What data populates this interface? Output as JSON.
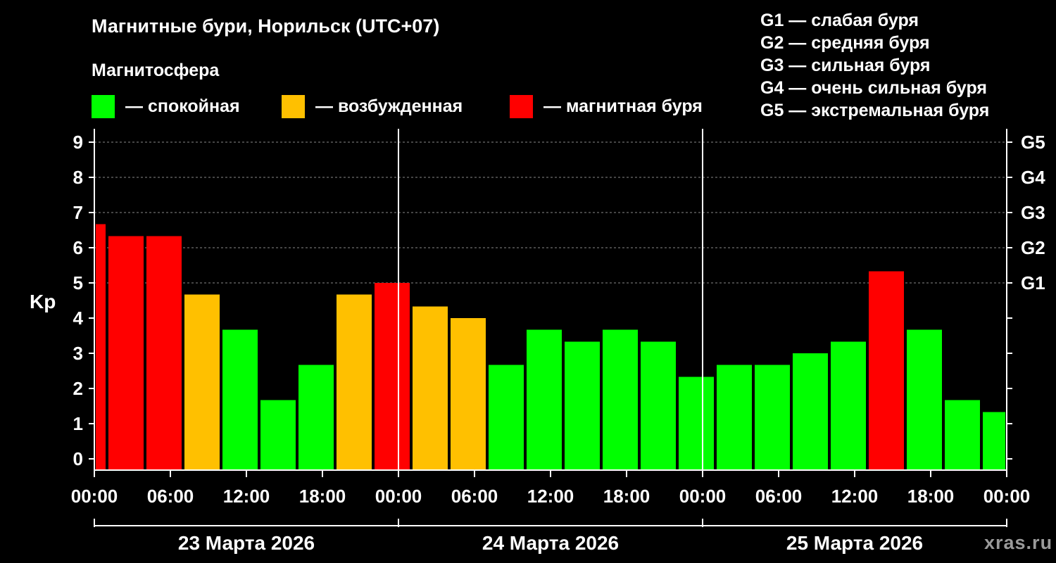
{
  "title": "Магнитные бури, Норильск (UTC+07)",
  "subtitle": "Магнитосфера",
  "legend": [
    {
      "label": "— спокойная",
      "color": "#00ff00"
    },
    {
      "label": "— возбужденная",
      "color": "#ffc000"
    },
    {
      "label": "— магнитная буря",
      "color": "#ff0000"
    }
  ],
  "g_legend": [
    "G1 — слабая буря",
    "G2 — средняя буря",
    "G3 — сильная буря",
    "G4 — очень сильная буря",
    "G5 — экстремальная буря"
  ],
  "watermark": "xras.ru",
  "chart_data": {
    "type": "bar",
    "ylabel": "Kp",
    "ylim": [
      0,
      9
    ],
    "yticks": [
      "0",
      "1",
      "2",
      "3",
      "4",
      "5",
      "6",
      "7",
      "8",
      "9"
    ],
    "right_labels": [
      {
        "value": 5,
        "label": "G1"
      },
      {
        "value": 6,
        "label": "G2"
      },
      {
        "value": 7,
        "label": "G3"
      },
      {
        "value": 8,
        "label": "G4"
      },
      {
        "value": 9,
        "label": "G5"
      }
    ],
    "x_tick_labels": [
      "00:00",
      "06:00",
      "12:00",
      "18:00",
      "00:00",
      "06:00",
      "12:00",
      "18:00",
      "00:00",
      "06:00",
      "12:00",
      "18:00",
      "00:00"
    ],
    "day_labels": [
      "23 Марта 2026",
      "24 Марта 2026",
      "25 Марта 2026"
    ],
    "grid": "horizontal dashed at 5-9",
    "bars": [
      {
        "start_hour": 0,
        "end_hour": 1,
        "value": 6.67,
        "color": "#ff0000"
      },
      {
        "start_hour": 1,
        "end_hour": 4,
        "value": 6.33,
        "color": "#ff0000"
      },
      {
        "start_hour": 4,
        "end_hour": 7,
        "value": 6.33,
        "color": "#ff0000"
      },
      {
        "start_hour": 7,
        "end_hour": 10,
        "value": 4.67,
        "color": "#ffc000"
      },
      {
        "start_hour": 10,
        "end_hour": 13,
        "value": 3.67,
        "color": "#00ff00"
      },
      {
        "start_hour": 13,
        "end_hour": 16,
        "value": 1.67,
        "color": "#00ff00"
      },
      {
        "start_hour": 16,
        "end_hour": 19,
        "value": 2.67,
        "color": "#00ff00"
      },
      {
        "start_hour": 19,
        "end_hour": 22,
        "value": 4.67,
        "color": "#ffc000"
      },
      {
        "start_hour": 22,
        "end_hour": 25,
        "value": 5.0,
        "color": "#ff0000"
      },
      {
        "start_hour": 25,
        "end_hour": 28,
        "value": 4.33,
        "color": "#ffc000"
      },
      {
        "start_hour": 28,
        "end_hour": 31,
        "value": 4.0,
        "color": "#ffc000"
      },
      {
        "start_hour": 31,
        "end_hour": 34,
        "value": 2.67,
        "color": "#00ff00"
      },
      {
        "start_hour": 34,
        "end_hour": 37,
        "value": 3.67,
        "color": "#00ff00"
      },
      {
        "start_hour": 37,
        "end_hour": 40,
        "value": 3.33,
        "color": "#00ff00"
      },
      {
        "start_hour": 40,
        "end_hour": 43,
        "value": 3.67,
        "color": "#00ff00"
      },
      {
        "start_hour": 43,
        "end_hour": 46,
        "value": 3.33,
        "color": "#00ff00"
      },
      {
        "start_hour": 46,
        "end_hour": 49,
        "value": 2.33,
        "color": "#00ff00"
      },
      {
        "start_hour": 49,
        "end_hour": 52,
        "value": 2.67,
        "color": "#00ff00"
      },
      {
        "start_hour": 52,
        "end_hour": 55,
        "value": 2.67,
        "color": "#00ff00"
      },
      {
        "start_hour": 55,
        "end_hour": 58,
        "value": 3.0,
        "color": "#00ff00"
      },
      {
        "start_hour": 58,
        "end_hour": 61,
        "value": 3.33,
        "color": "#00ff00"
      },
      {
        "start_hour": 61,
        "end_hour": 64,
        "value": 5.33,
        "color": "#ff0000"
      },
      {
        "start_hour": 64,
        "end_hour": 67,
        "value": 3.67,
        "color": "#00ff00"
      },
      {
        "start_hour": 67,
        "end_hour": 70,
        "value": 1.67,
        "color": "#00ff00"
      },
      {
        "start_hour": 70,
        "end_hour": 72,
        "value": 1.33,
        "color": "#00ff00"
      }
    ]
  }
}
